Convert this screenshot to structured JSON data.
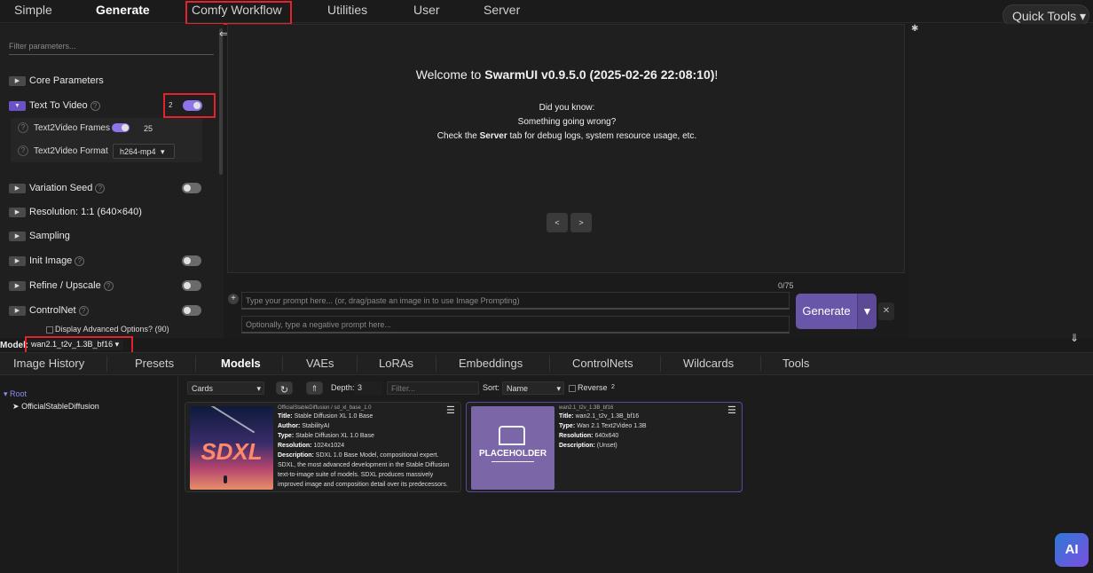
{
  "topnav": {
    "tabs": [
      "Simple",
      "Generate",
      "Comfy Workflow",
      "Utilities",
      "User",
      "Server"
    ],
    "quick_tools": "Quick Tools"
  },
  "left_panel": {
    "filter_placeholder": "Filter parameters...",
    "core_parameters": "Core Parameters",
    "text_to_video": "Text To Video",
    "text_to_video_badge": "2",
    "frames_label": "Text2Video Frames",
    "frames_value": "25",
    "format_label": "Text2Video Format",
    "format_value": "h264-mp4",
    "variation_seed": "Variation Seed",
    "resolution": "Resolution: 1:1 (640×640)",
    "sampling": "Sampling",
    "init_image": "Init Image",
    "refine_upscale": "Refine / Upscale",
    "controlnet": "ControlNet",
    "advanced_options": "Display Advanced Options? (90)",
    "help_glyph": "?"
  },
  "center": {
    "welcome_prefix": "Welcome to ",
    "welcome_bold": "SwarmUI v0.9.5.0 (2025-02-26 22:08:10)",
    "welcome_suffix": "!",
    "did_you_know": "Did you know:",
    "tip_line1": "Something going wrong?",
    "tip_line2_prefix": "Check the ",
    "tip_line2_bold": "Server",
    "tip_line2_suffix": " tab for debug logs, system resource usage, etc.",
    "prev": "<",
    "next": ">",
    "token_counter": "0/75",
    "prompt_placeholder": "Type your prompt here... (or, drag/paste an image in to use Image Prompting)",
    "negative_placeholder": "Optionally, type a negative prompt here...",
    "generate": "Generate"
  },
  "model_bar": {
    "label": "Model:",
    "value": "wan2.1_t2v_1.3B_bf16"
  },
  "bottom_tabs": [
    "Image History",
    "Presets",
    "Models",
    "VAEs",
    "LoRAs",
    "Embeddings",
    "ControlNets",
    "Wildcards",
    "Tools"
  ],
  "tree": {
    "root": "Root",
    "child": "OfficialStableDiffusion"
  },
  "browser": {
    "view": "Cards",
    "depth_label": "Depth:",
    "depth_value": "3",
    "filter_placeholder": "Filter...",
    "sort_label": "Sort:",
    "sort_value": "Name",
    "reverse_label": "Reverse",
    "reverse_count": "2",
    "cards": [
      {
        "path": "OfficialStableDiffusion / sd_xl_base_1.0",
        "title": "Stable Diffusion XL 1.0 Base",
        "author": "StabilityAI",
        "type": "Stable Diffusion XL 1.0 Base",
        "resolution": "1024x1024",
        "description": "SDXL 1.0 Base Model, compositional expert. SDXL, the most advanced development in the Stable Diffusion text-to-image suite of models. SDXL produces massively improved image and composition detail over its predecessors. The ability to generate hyper-realistic creations for films",
        "thumb_text": "SDXL"
      },
      {
        "path": "wan2.1_t2v_1.3B_bf16",
        "title": "wan2.1_t2v_1.3B_bf16",
        "type": "Wan 2.1 Text2Video 1.3B",
        "resolution": "640x640",
        "description": "(Unset)",
        "thumb_text": "PLACEHOLDER"
      }
    ]
  },
  "labels": {
    "title": "Title:",
    "author": "Author:",
    "type": "Type:",
    "resolution": "Resolution:",
    "description": "Description:"
  },
  "logo_text": "AI",
  "colors": {
    "accent": "#6a56a8",
    "toggle_on": "#8e73ea",
    "highlight_box": "#e2232b"
  }
}
